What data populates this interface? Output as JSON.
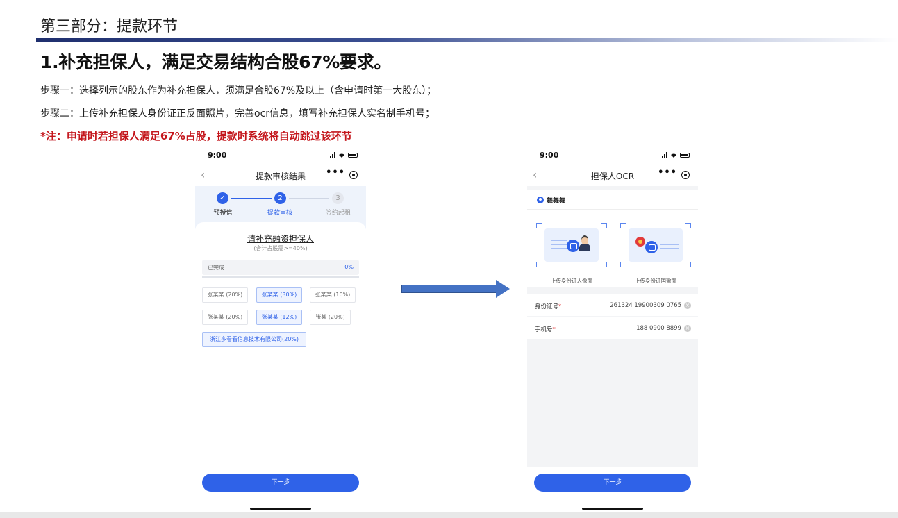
{
  "slide": {
    "section_title": "第三部分：提款环节",
    "headline": "1.补充担保人，满足交易结构合股67%要求。",
    "step1": "步骤一：选择列示的股东作为补充担保人，须满足合股67%及以上（含申请时第一大股东）；",
    "step2": "步骤二：上传补充担保人身份证正反面照片，完善ocr信息，填写补充担保人实名制手机号；",
    "note": "*注：申请时若担保人满足67%占股，提款时系统将自动跳过该环节"
  },
  "phone_left": {
    "time": "9:00",
    "nav_title": "提款审核结果",
    "back_glyph": "‹",
    "more_glyph": "•••",
    "steps": [
      {
        "num": "✓",
        "label": "预授信"
      },
      {
        "num": "2",
        "label": "提款审核"
      },
      {
        "num": "3",
        "label": "签约起租"
      }
    ],
    "sheet_title": "请补充融资担保人",
    "sheet_subtitle": "(合计占股需>=40%)",
    "done_label": "已完成",
    "done_pct": "0%",
    "chips": [
      {
        "label": "张某某 (20%)",
        "selected": false
      },
      {
        "label": "张某某 (30%)",
        "selected": true
      },
      {
        "label": "张某某 (10%)",
        "selected": false
      },
      {
        "label": "张某某 (20%)",
        "selected": false
      },
      {
        "label": "张某某 (12%)",
        "selected": true
      },
      {
        "label": "张某 (20%)",
        "selected": false
      },
      {
        "label": "浙江多看看信息技术有限公司(20%)",
        "selected": false
      }
    ],
    "next_label": "下一步"
  },
  "phone_right": {
    "time": "9:00",
    "nav_title": "担保人OCR",
    "back_glyph": "‹",
    "more_glyph": "•••",
    "user_name": "舞舞舞",
    "card_front_caption": "上传身份证人像面",
    "card_back_caption": "上传身份证国徽面",
    "id_label": "身份证号",
    "id_value": "261324 19900309 0765",
    "phone_label": "手机号",
    "phone_value": "188 0900 8899",
    "required_mark": "*",
    "clear_glyph": "×",
    "next_label": "下一步"
  },
  "colors": {
    "accent": "#2f62e8",
    "note_red": "#c4161c",
    "arrow_blue": "#4472c4",
    "title_bar": "#1f2f6e"
  },
  "icons": [
    "signal-icon",
    "wifi-icon",
    "battery-icon",
    "back-icon",
    "more-icon",
    "target-icon",
    "user-icon",
    "camera-icon",
    "clear-icon",
    "arrow-right-icon"
  ]
}
